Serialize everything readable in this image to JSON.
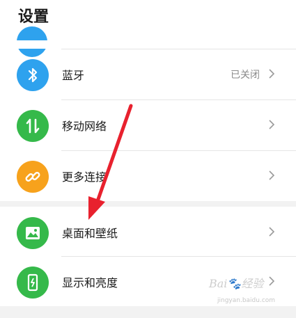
{
  "header": {
    "title": "设置"
  },
  "settings": {
    "items": [
      {
        "label": "蓝牙",
        "value": "已关闭",
        "icon": "bluetooth-icon",
        "color": "#2ea2ee"
      },
      {
        "label": "移动网络",
        "value": "",
        "icon": "mobile-network-icon",
        "color": "#35b94a"
      },
      {
        "label": "更多连接",
        "value": "",
        "icon": "link-icon",
        "color": "#f7a21c"
      },
      {
        "label": "桌面和壁纸",
        "value": "",
        "icon": "wallpaper-icon",
        "color": "#35b94a"
      },
      {
        "label": "显示和亮度",
        "value": "",
        "icon": "display-brightness-icon",
        "color": "#35b94a"
      }
    ]
  },
  "annotation": {
    "arrow_color": "#e8212e"
  },
  "watermark": {
    "brand": "Bai🐾经验",
    "url": "jingyan.baidu.com"
  }
}
